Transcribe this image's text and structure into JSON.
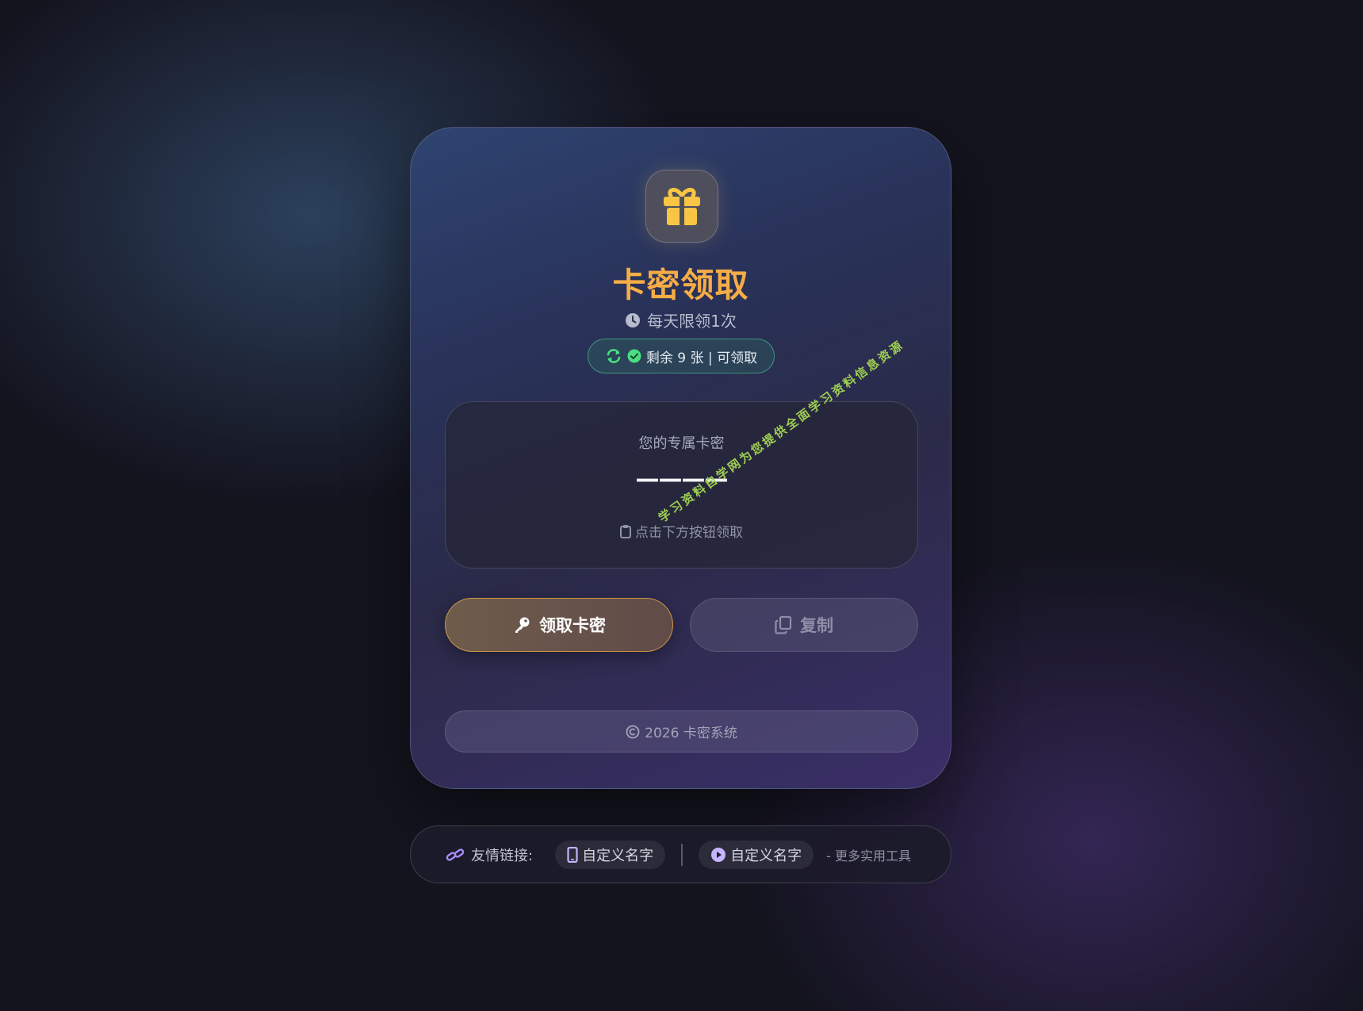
{
  "card": {
    "title": "卡密领取",
    "subtitle": "每天限领1次",
    "status": "剩余 9 张 | 可领取",
    "code_box": {
      "label": "您的专属卡密",
      "value": "————",
      "hint": "点击下方按钮领取"
    },
    "buttons": {
      "get": "领取卡密",
      "copy": "复制"
    },
    "footer": "2026 卡密系统",
    "watermark": "学习资料自学网为您提供全面学习资料信息资源"
  },
  "links": {
    "label": "友情链接:",
    "items": [
      {
        "label": "自定义名字",
        "icon": "phone-icon"
      },
      {
        "label": "自定义名字",
        "icon": "play-icon"
      }
    ],
    "more": "- 更多实用工具"
  },
  "colors": {
    "accent": "#f6ad45",
    "success": "#4ade80",
    "link_icon": "#a78bfa"
  }
}
